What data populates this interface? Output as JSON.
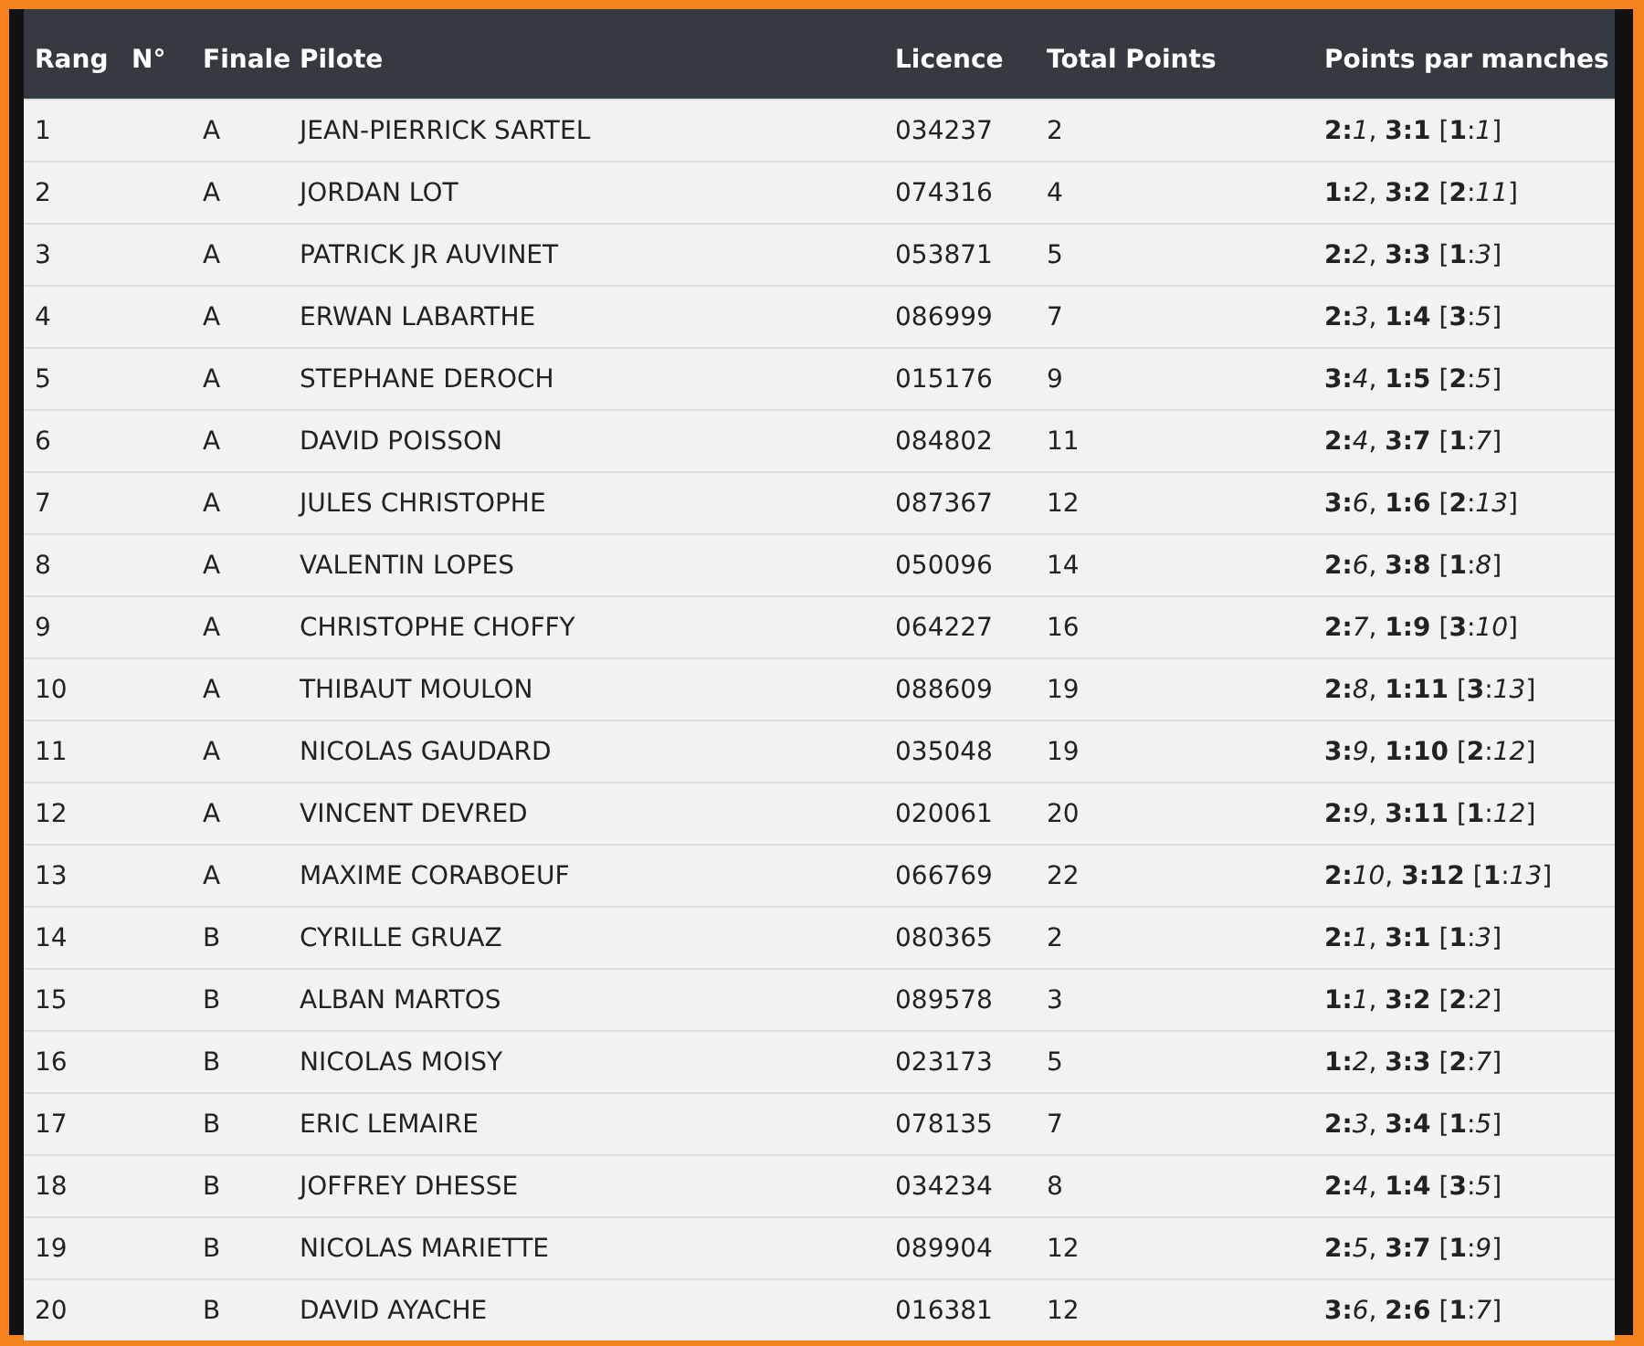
{
  "table": {
    "columns": [
      "Rang",
      "N°",
      "Finale",
      "Pilote",
      "Licence",
      "Total Points",
      "Points par manches"
    ],
    "rows": [
      {
        "rang": "1",
        "finale": "A",
        "pilote": "JEAN-PIERRICK SARTEL",
        "licence": "034237",
        "total": "2",
        "manches": [
          "**2:**",
          "*1*",
          ", **3:1** [**1**:*1*]"
        ]
      },
      {
        "rang": "2",
        "finale": "A",
        "pilote": "JORDAN LOT",
        "licence": "074316",
        "total": "4",
        "manches": [
          "**1:**",
          "*2*",
          ", **3:2** [**2**:*11*]"
        ]
      },
      {
        "rang": "3",
        "finale": "A",
        "pilote": "PATRICK JR AUVINET",
        "licence": "053871",
        "total": "5",
        "manches": [
          "**2:**",
          "*2*",
          ", **3:3** [**1**:*3*]"
        ]
      },
      {
        "rang": "4",
        "finale": "A",
        "pilote": "ERWAN LABARTHE",
        "licence": "086999",
        "total": "7",
        "manches": [
          "**2:**",
          "*3*",
          ", **1:4** [**3**:*5*]"
        ]
      },
      {
        "rang": "5",
        "finale": "A",
        "pilote": "STEPHANE DEROCH",
        "licence": "015176",
        "total": "9",
        "manches": [
          "**3:**",
          "*4*",
          ", **1:5** [**2**:*5*]"
        ]
      },
      {
        "rang": "6",
        "finale": "A",
        "pilote": "DAVID POISSON",
        "licence": "084802",
        "total": "11",
        "manches": [
          "**2:**",
          "*4*",
          ", **3:7** [**1**:*7*]"
        ]
      },
      {
        "rang": "7",
        "finale": "A",
        "pilote": "JULES CHRISTOPHE",
        "licence": "087367",
        "total": "12",
        "manches": [
          "**3:**",
          "*6*",
          ", **1:6** [**2**:*13*]"
        ]
      },
      {
        "rang": "8",
        "finale": "A",
        "pilote": "VALENTIN LOPES",
        "licence": "050096",
        "total": "14",
        "manches": [
          "**2:**",
          "*6*",
          ", **3:8** [**1**:*8*]"
        ]
      },
      {
        "rang": "9",
        "finale": "A",
        "pilote": "CHRISTOPHE CHOFFY",
        "licence": "064227",
        "total": "16",
        "manches": [
          "**2:**",
          "*7*",
          ", **1:9** [**3**:*10*]"
        ]
      },
      {
        "rang": "10",
        "finale": "A",
        "pilote": "THIBAUT MOULON",
        "licence": "088609",
        "total": "19",
        "manches": [
          "**2:**",
          "*8*",
          ", **1:11** [**3**:*13*]"
        ]
      },
      {
        "rang": "11",
        "finale": "A",
        "pilote": "NICOLAS GAUDARD",
        "licence": "035048",
        "total": "19",
        "manches": [
          "**3:**",
          "*9*",
          ", **1:10** [**2**:*12*]"
        ]
      },
      {
        "rang": "12",
        "finale": "A",
        "pilote": "VINCENT DEVRED",
        "licence": "020061",
        "total": "20",
        "manches": [
          "**2:**",
          "*9*",
          ", **3:11** [**1**:*12*]"
        ]
      },
      {
        "rang": "13",
        "finale": "A",
        "pilote": "MAXIME CORABOEUF",
        "licence": "066769",
        "total": "22",
        "manches": [
          "**2:**",
          "*10*",
          ", **3:12** [**1**:*13*]"
        ]
      },
      {
        "rang": "14",
        "finale": "B",
        "pilote": "CYRILLE GRUAZ",
        "licence": "080365",
        "total": "2",
        "manches": [
          "**2:**",
          "*1*",
          ", **3:1** [**1**:*3*]"
        ]
      },
      {
        "rang": "15",
        "finale": "B",
        "pilote": "ALBAN MARTOS",
        "licence": "089578",
        "total": "3",
        "manches": [
          "**1:**",
          "*1*",
          ", **3:2** [**2**:*2*]"
        ]
      },
      {
        "rang": "16",
        "finale": "B",
        "pilote": "NICOLAS MOISY",
        "licence": "023173",
        "total": "5",
        "manches": [
          "**1:**",
          "*2*",
          ", **3:3** [**2**:*7*]"
        ]
      },
      {
        "rang": "17",
        "finale": "B",
        "pilote": "ERIC LEMAIRE",
        "licence": "078135",
        "total": "7",
        "manches": [
          "**2:**",
          "*3*",
          ", **3:4** [**1**:*5*]"
        ]
      },
      {
        "rang": "18",
        "finale": "B",
        "pilote": "JOFFREY DHESSE",
        "licence": "034234",
        "total": "8",
        "manches": [
          "**2:**",
          "*4*",
          ", **1:4** [**3**:*5*]"
        ]
      },
      {
        "rang": "19",
        "finale": "B",
        "pilote": "NICOLAS MARIETTE",
        "licence": "089904",
        "total": "12",
        "manches": [
          "**2:**",
          "*5*",
          ", **3:7** [**1**:*9*]"
        ]
      },
      {
        "rang": "20",
        "finale": "B",
        "pilote": "DAVID AYACHE",
        "licence": "016381",
        "total": "12",
        "manches": [
          "**3:**",
          "*6*",
          ", **2:6** [**1**:*7*]"
        ]
      }
    ]
  }
}
